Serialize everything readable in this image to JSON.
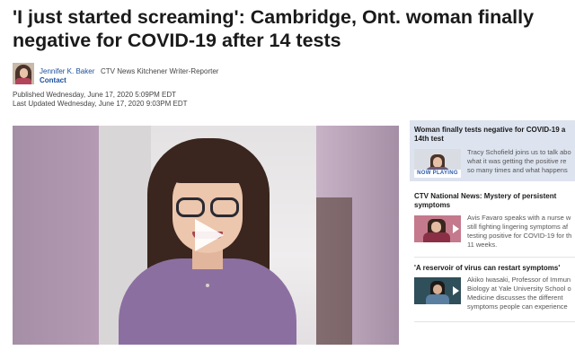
{
  "article": {
    "headline_line1": "'I just started screaming': Cambridge, Ont. woman finally",
    "headline_line2": "negative for COVID-19 after 14 tests",
    "author": "Jennifer K. Baker",
    "author_role": "CTV News Kitchener Writer-Reporter",
    "contact_label": "Contact",
    "published": "Published Wednesday, June 17, 2020 5:09PM EDT",
    "updated": "Last Updated Wednesday, June 17, 2020 9:03PM EDT"
  },
  "player": {
    "play_icon": "play-icon"
  },
  "related": [
    {
      "title_line1": "Woman finally tests negative for COVID-19 a",
      "title_line2": "14th test",
      "desc_line1": "Tracy Schofield joins us to talk abo",
      "desc_line2": "what it was getting the positive re",
      "desc_line3": "so many times and what happens",
      "badge": "NOW PLAYING"
    },
    {
      "title_line1": "CTV National News: Mystery of persistent",
      "title_line2": "symptoms",
      "desc_line1": "Avis Favaro speaks with a nurse w",
      "desc_line2": "still fighting lingering symptoms af",
      "desc_line3": "testing positive for COVID-19 for th",
      "desc_line4": "11 weeks."
    },
    {
      "title_line1": "'A reservoir of virus can restart symptoms'",
      "desc_line1": "Akiko Iwasaki, Professor of Immun",
      "desc_line2": "Biology at Yale University School o",
      "desc_line3": "Medicine discusses the different",
      "desc_line4": "symptoms people can experience"
    }
  ],
  "colors": {
    "link": "#1a4f9c",
    "now_playing_bg": "#dde4ef",
    "now_playing_text": "#2a5bb0"
  }
}
